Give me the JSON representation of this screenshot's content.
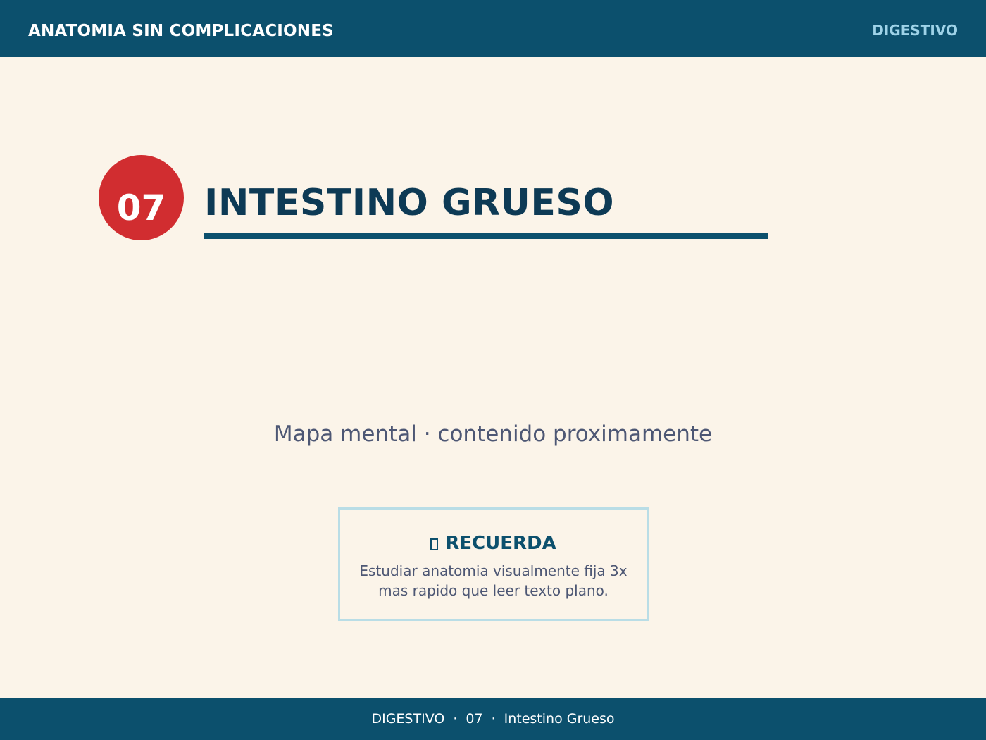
{
  "header": {
    "brand": "ANATOMIA SIN COMPLICACIONES",
    "section": "DIGESTIVO"
  },
  "chapter": {
    "number": "07",
    "title": "INTESTINO GRUESO"
  },
  "main": {
    "subtitle": "Mapa mental · contenido proximamente"
  },
  "note": {
    "icon": "placeholder-glyph-icon",
    "heading": "RECUERDA",
    "text": "Estudiar anatomia visualmente fija 3x mas rapido que leer texto plano."
  },
  "footer": {
    "section": "DIGESTIVO",
    "separator": "·",
    "number": "07",
    "title": "Intestino Grueso"
  },
  "colors": {
    "header_bg": "#0c506d",
    "page_bg": "#fbf4e9",
    "badge_bg": "#d12d30",
    "title_text": "#0d3a55",
    "accent_light": "#9fd3e8",
    "note_border": "#b9dde6"
  }
}
